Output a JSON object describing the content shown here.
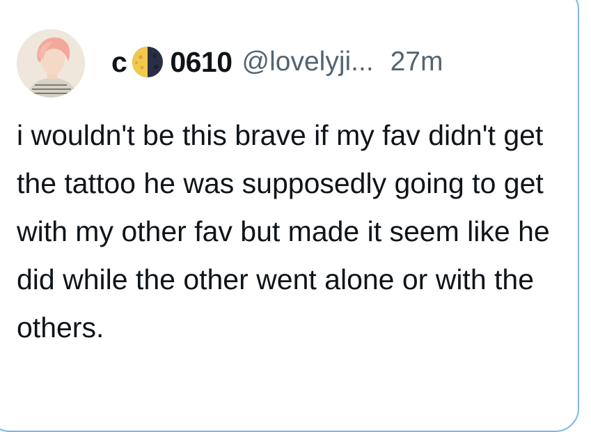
{
  "tweet": {
    "display_name_prefix": "c",
    "display_name_emoji": "moon-icon",
    "display_name_suffix": "0610",
    "handle": "@lovelyji...",
    "timestamp": "27m",
    "text": "i wouldn't be this brave if my fav didn't get the tattoo he was supposedly going to get with my other fav but made it seem like he did while the other went alone or with the others."
  },
  "colors": {
    "text": "#0f1419",
    "muted": "#536471",
    "card_border": "#7fb4e6"
  }
}
